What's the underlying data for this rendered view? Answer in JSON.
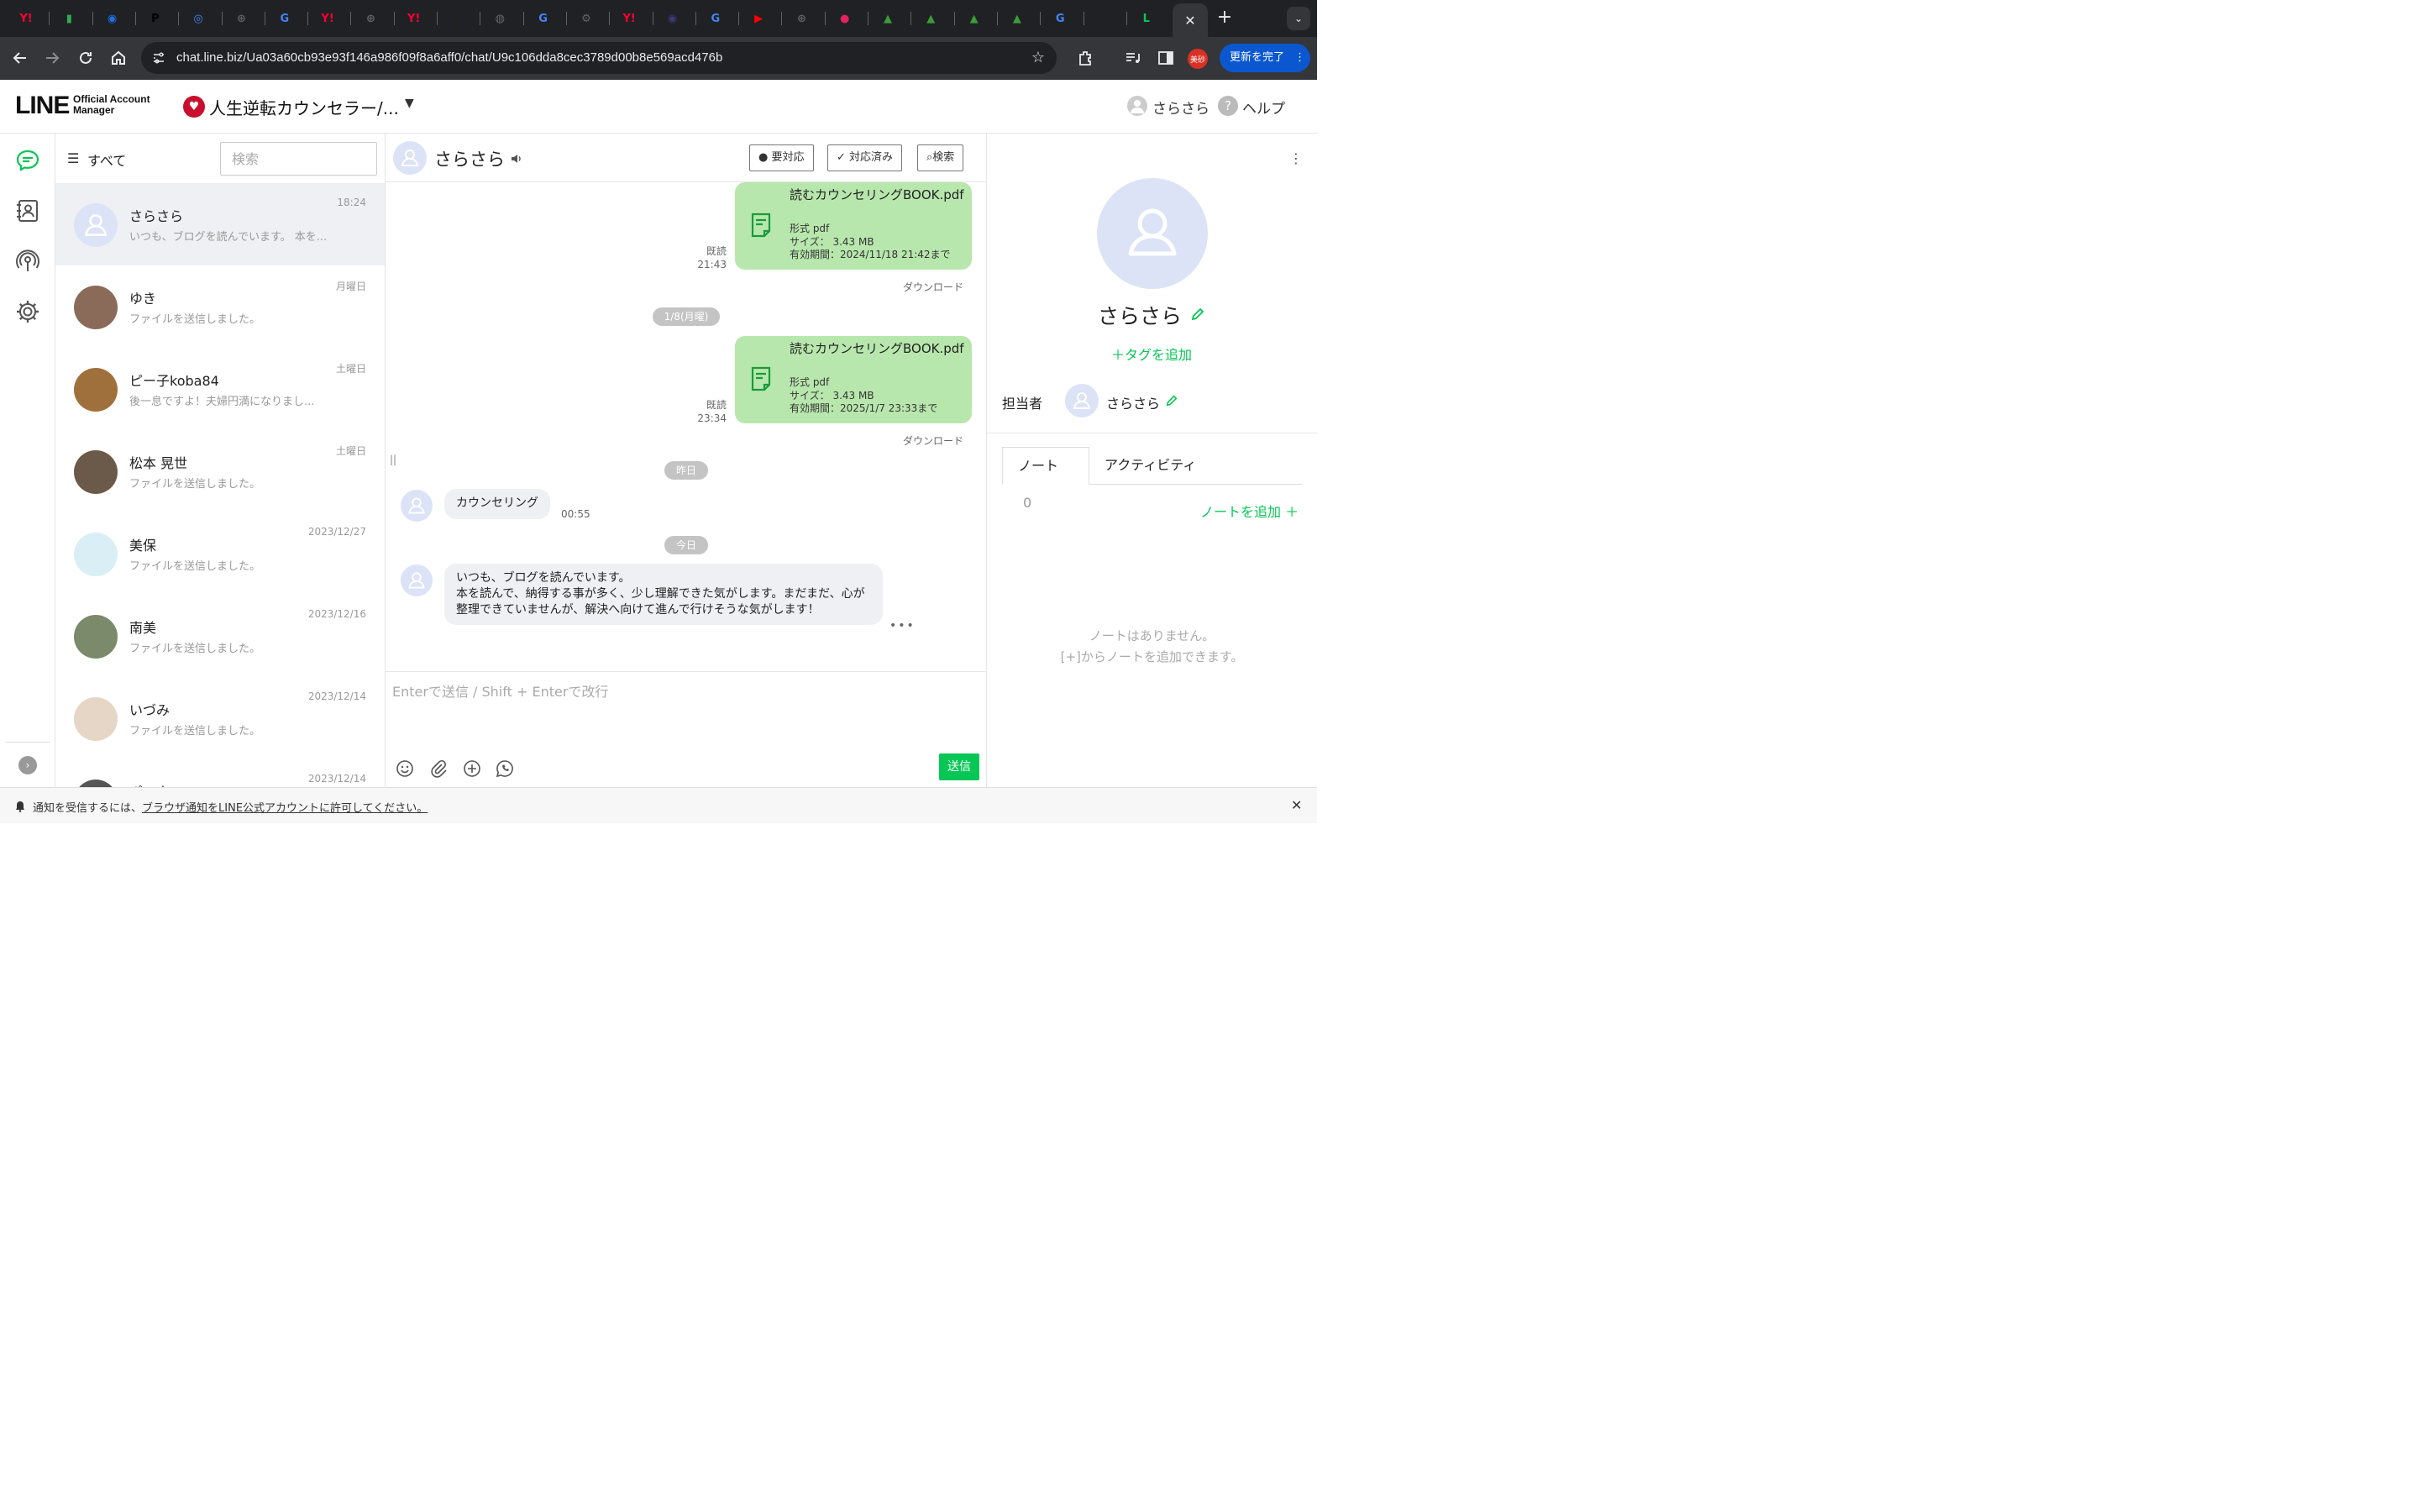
{
  "browser": {
    "tabs": [
      {
        "glyph": "Y!",
        "color": "#ff0033"
      },
      {
        "glyph": "▮",
        "color": "#34a853"
      },
      {
        "glyph": "◉",
        "color": "#1a73e8"
      },
      {
        "glyph": "P",
        "color": "#000000"
      },
      {
        "glyph": "◎",
        "color": "#4285f4"
      },
      {
        "glyph": "⊕",
        "color": "#5f6368"
      },
      {
        "glyph": "G",
        "color": "#4285f4"
      },
      {
        "glyph": "Y!",
        "color": "#ff0033"
      },
      {
        "glyph": "⊕",
        "color": "#5f6368"
      },
      {
        "glyph": "Y!",
        "color": "#ff0033"
      },
      {
        "glyph": "b",
        "color": "#222222"
      },
      {
        "glyph": "◍",
        "color": "#666666"
      },
      {
        "glyph": "G",
        "color": "#4285f4"
      },
      {
        "glyph": "⚙",
        "color": "#5f6368"
      },
      {
        "glyph": "Y!",
        "color": "#ff0033"
      },
      {
        "glyph": "◉",
        "color": "#3a3a7a"
      },
      {
        "glyph": "G",
        "color": "#4285f4"
      },
      {
        "glyph": "▶",
        "color": "#ff0000"
      },
      {
        "glyph": "⊕",
        "color": "#5f6368"
      },
      {
        "glyph": "●",
        "color": "#e0245e"
      },
      {
        "glyph": "▲",
        "color": "#3a9d3a"
      },
      {
        "glyph": "▲",
        "color": "#3a9d3a"
      },
      {
        "glyph": "▲",
        "color": "#3a9d3a"
      },
      {
        "glyph": "▲",
        "color": "#3a9d3a"
      },
      {
        "glyph": "G",
        "color": "#4285f4"
      },
      {
        "glyph": "LY",
        "color": "#202124"
      },
      {
        "glyph": "L",
        "color": "#06c755"
      }
    ],
    "active_tab_close": "✕",
    "new_tab": "+",
    "tab_search": "⌄",
    "url": "chat.line.biz/Ua03a60cb93e93f146a986f09f8a6aff0/chat/U9c106dda8cec3789d00b8e569acd476b",
    "profile_badge": "美砂",
    "update_button": "更新を完了",
    "update_menu": "⋮"
  },
  "header": {
    "logo_main": "LINE",
    "logo_sub_1": "Official Account",
    "logo_sub_2": "Manager",
    "account_icon": "♥",
    "account_name": "人生逆転カウンセラー/...",
    "account_caret": "▼",
    "user_name": "さらさら",
    "help_icon": "?",
    "help_label": "ヘルプ"
  },
  "chat_list": {
    "filter_label": "すべて",
    "search_placeholder": "検索",
    "items": [
      {
        "name": "さらさら",
        "message": "いつも、ブログを読んでいます。 本を...",
        "time": "18:24",
        "selected": true
      },
      {
        "name": "ゆき",
        "message": "ファイルを送信しました。",
        "time": "月曜日"
      },
      {
        "name": "ピー子koba84",
        "message": "後一息ですよ！夫婦円満になりまし...",
        "time": "土曜日"
      },
      {
        "name": "松本 晃世",
        "message": "ファイルを送信しました。",
        "time": "土曜日"
      },
      {
        "name": "美保",
        "message": "ファイルを送信しました。",
        "time": "2023/12/27"
      },
      {
        "name": "南美",
        "message": "ファイルを送信しました。",
        "time": "2023/12/16"
      },
      {
        "name": "いづみ",
        "message": "ファイルを送信しました。",
        "time": "2023/12/14"
      },
      {
        "name": "ポン太",
        "message": "",
        "time": "2023/12/14"
      }
    ]
  },
  "chat": {
    "contact_name": "さらさら",
    "speaker_icon": "🔈",
    "btn_needs_action": "要対応",
    "btn_done": "対応済み",
    "btn_search": "検索",
    "files": [
      {
        "title": "読むカウンセリングBOOK.pdf",
        "format": "形式 pdf",
        "size": "サイズ： 3.43 MB",
        "expiry": "有効期間：2024/11/18 21:42まで",
        "read": "既読",
        "time": "21:43",
        "download": "ダウンロード"
      },
      {
        "title": "読むカウンセリングBOOK.pdf",
        "format": "形式 pdf",
        "size": "サイズ： 3.43 MB",
        "expiry": "有効期間：2025/1/7 23:33まで",
        "read": "既読",
        "time": "23:34",
        "download": "ダウンロード"
      }
    ],
    "date_1": "1/8(月曜)",
    "date_2": "昨日",
    "date_3": "今日",
    "incoming_1": {
      "text": "カウンセリング",
      "time": "00:55"
    },
    "incoming_2": {
      "text": "いつも、ブログを読んでいます。\n本を読んで、納得する事が多く、少し理解できた気がします。まだまだ、心が整理できていませんが、解決へ向けて進んで行けそうな気がします！"
    },
    "more_dots": "•••",
    "resize_handle": "||",
    "composer_placeholder": "Enterで送信 / Shift + Enterで改行",
    "send_label": "送信"
  },
  "profile": {
    "more": "⋮",
    "name": "さらさら",
    "add_tag": "＋タグを追加",
    "assignee_label": "担当者",
    "assignee_name": "さらさら",
    "tab_note": "ノート",
    "tab_note_count": "0",
    "tab_activity": "アクティビティ",
    "add_note": "ノートを追加 ＋",
    "empty_line_1": "ノートはありません。",
    "empty_line_2": "[+]からノートを追加できます。"
  },
  "notification": {
    "text_before": "通知を受信するには、",
    "link": "ブラウザ通知をLINE公式アカウントに許可してください。",
    "close": "✕"
  },
  "colors": {
    "brand_green": "#06c755",
    "bubble_green": "#b8e7ad",
    "browser_dark": "#202124"
  }
}
